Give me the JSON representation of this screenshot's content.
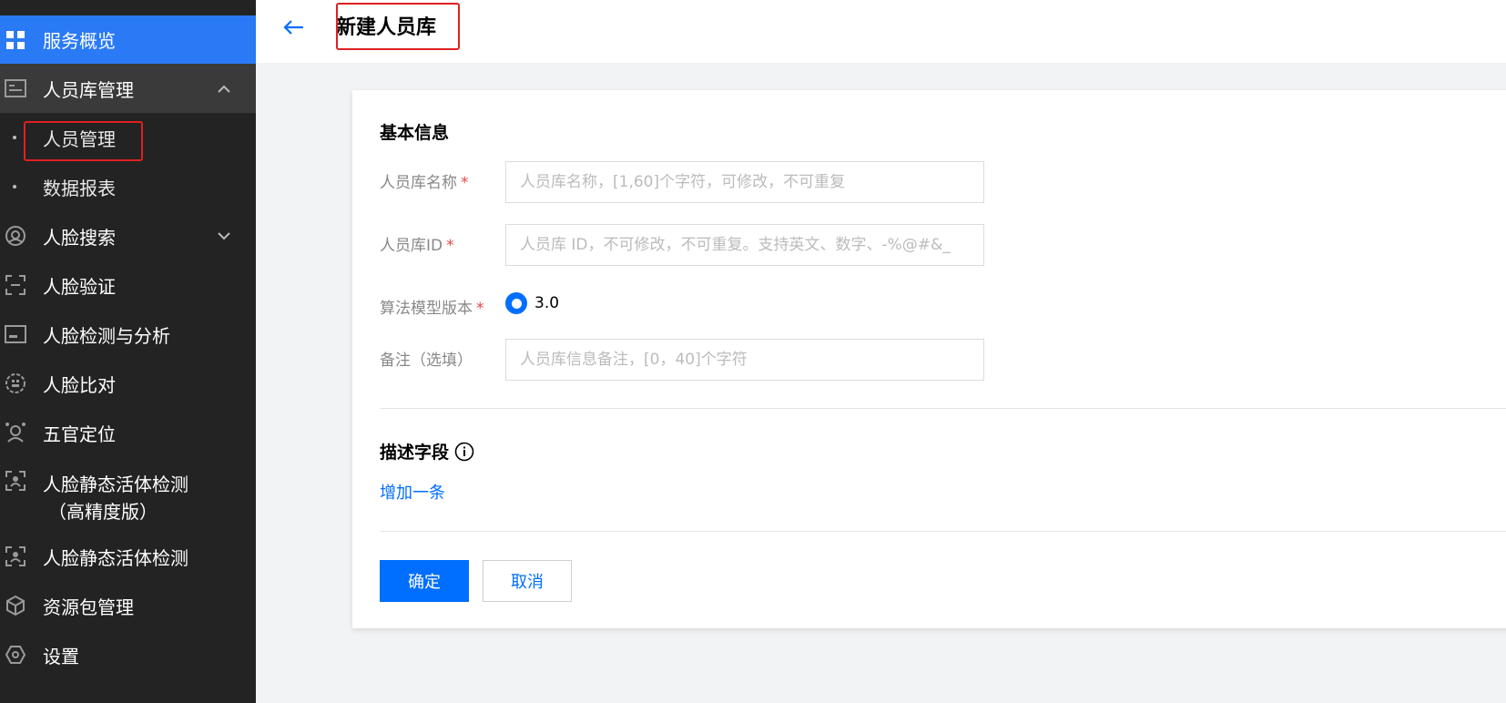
{
  "sidebar": {
    "items": [
      {
        "label": "服务概览"
      },
      {
        "label": "人员库管理"
      },
      {
        "label": "人员管理"
      },
      {
        "label": "数据报表"
      },
      {
        "label": "人脸搜索"
      },
      {
        "label": "人脸验证"
      },
      {
        "label": "人脸检测与分析"
      },
      {
        "label": "人脸比对"
      },
      {
        "label": "五官定位"
      },
      {
        "label": "人脸静态活体检测",
        "label2": "（高精度版）"
      },
      {
        "label": "人脸静态活体检测"
      },
      {
        "label": "资源包管理"
      },
      {
        "label": "设置"
      }
    ]
  },
  "header": {
    "title": "新建人员库"
  },
  "form": {
    "basic_section": "基本信息",
    "name_label": "人员库名称",
    "name_placeholder": "人员库名称，[1,60]个字符，可修改，不可重复",
    "id_label": "人员库ID",
    "id_placeholder": "人员库 ID，不可修改，不可重复。支持英文、数字、-%@#&_",
    "model_label": "算法模型版本",
    "model_value": "3.0",
    "remark_label": "备注（选填）",
    "remark_placeholder": "人员库信息备注，[0，40]个字符",
    "required_mark": "*",
    "desc_section": "描述字段",
    "add_link": "增加一条",
    "confirm_label": "确定",
    "cancel_label": "取消"
  },
  "colors": {
    "sidebar_bg": "#232323",
    "sidebar_active": "#2a7af5",
    "accent": "#006eff",
    "highlight_box": "#e02020"
  }
}
